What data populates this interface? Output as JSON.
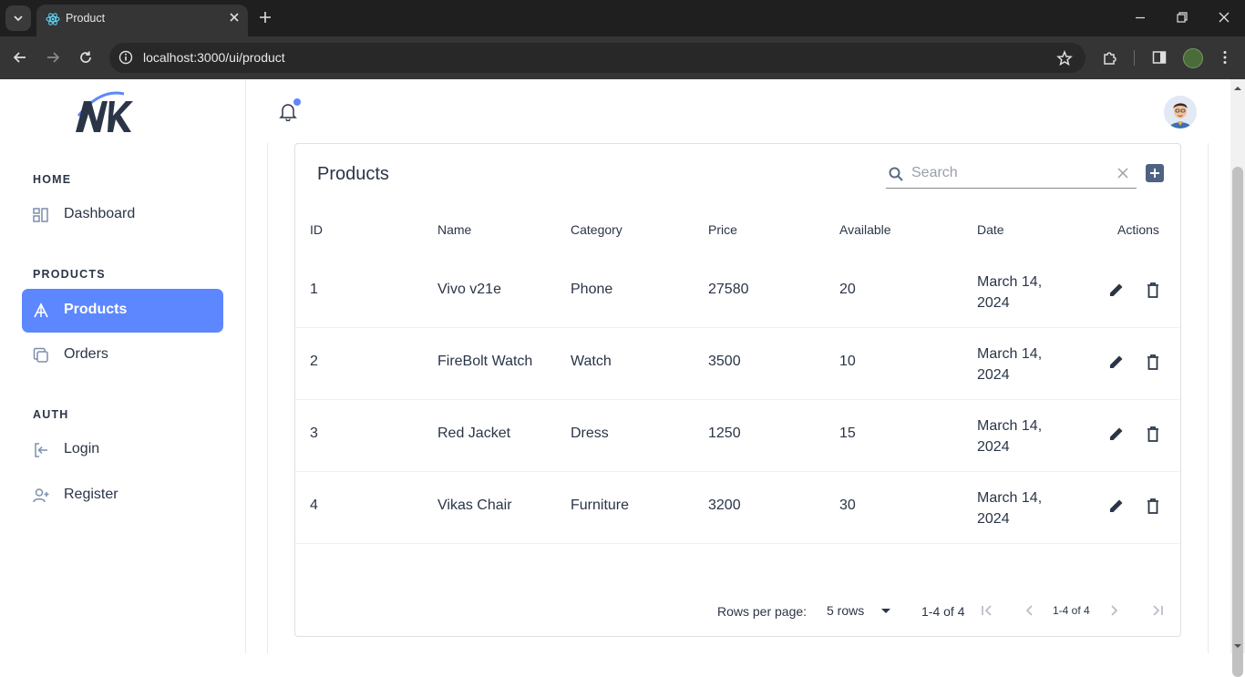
{
  "browser": {
    "tab_title": "Product",
    "url": "localhost:3000/ui/product"
  },
  "sidebar": {
    "sections": [
      {
        "title": "HOME",
        "items": [
          {
            "label": "Dashboard",
            "icon": "dashboard-icon"
          }
        ]
      },
      {
        "title": "PRODUCTS",
        "items": [
          {
            "label": "Products",
            "icon": "product-icon",
            "active": true
          },
          {
            "label": "Orders",
            "icon": "orders-icon"
          }
        ]
      },
      {
        "title": "AUTH",
        "items": [
          {
            "label": "Login",
            "icon": "login-icon"
          },
          {
            "label": "Register",
            "icon": "register-icon"
          }
        ]
      }
    ]
  },
  "colors": {
    "accent": "#5d87ff",
    "text": "#2a3547"
  },
  "products": {
    "title": "Products",
    "search_placeholder": "Search",
    "columns": [
      "ID",
      "Name",
      "Category",
      "Price",
      "Available",
      "Date",
      "Actions"
    ],
    "rows": [
      {
        "id": "1",
        "name": "Vivo v21e",
        "category": "Phone",
        "price": "27580",
        "available": "20",
        "date_l1": "March 14,",
        "date_l2": "2024"
      },
      {
        "id": "2",
        "name": "FireBolt Watch",
        "category": "Watch",
        "price": "3500",
        "available": "10",
        "date_l1": "March 14,",
        "date_l2": "2024"
      },
      {
        "id": "3",
        "name": "Red Jacket",
        "category": "Dress",
        "price": "1250",
        "available": "15",
        "date_l1": "March 14,",
        "date_l2": "2024"
      },
      {
        "id": "4",
        "name": "Vikas Chair",
        "category": "Furniture",
        "price": "3200",
        "available": "30",
        "date_l1": "March 14,",
        "date_l2": "2024"
      }
    ],
    "pagination": {
      "rows_per_page_label": "Rows per page:",
      "rows_per_page_value": "5 rows",
      "range": "1-4 of 4",
      "range_mid": "1-4 of 4"
    }
  }
}
